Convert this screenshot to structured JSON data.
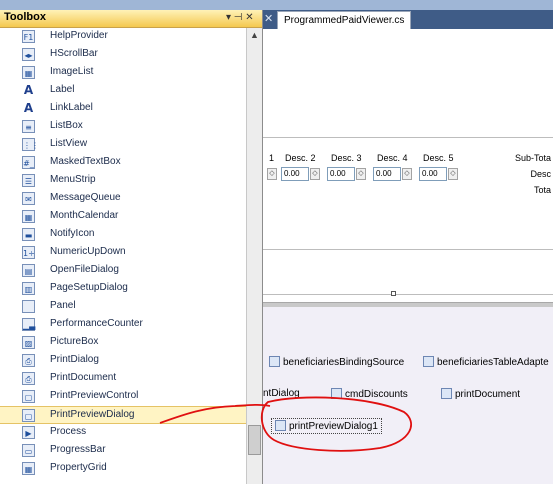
{
  "toolbox": {
    "title": "Toolbox",
    "pin_label": "▾ ⊣ ✕",
    "items": [
      {
        "label": "HelpProvider",
        "icon": "help-provider-icon",
        "glyph": "F1"
      },
      {
        "label": "HScrollBar",
        "icon": "hscrollbar-icon",
        "glyph": "◂▸"
      },
      {
        "label": "ImageList",
        "icon": "imagelist-icon",
        "glyph": "▦"
      },
      {
        "label": "Label",
        "icon": "label-icon",
        "glyph": "A"
      },
      {
        "label": "LinkLabel",
        "icon": "linklabel-icon",
        "glyph": "A"
      },
      {
        "label": "ListBox",
        "icon": "listbox-icon",
        "glyph": "≡"
      },
      {
        "label": "ListView",
        "icon": "listview-icon",
        "glyph": "⋮⋮"
      },
      {
        "label": "MaskedTextBox",
        "icon": "maskedtextbox-icon",
        "glyph": "#_"
      },
      {
        "label": "MenuStrip",
        "icon": "menustrip-icon",
        "glyph": "☰"
      },
      {
        "label": "MessageQueue",
        "icon": "messagequeue-icon",
        "glyph": "✉"
      },
      {
        "label": "MonthCalendar",
        "icon": "monthcalendar-icon",
        "glyph": "▦"
      },
      {
        "label": "NotifyIcon",
        "icon": "notifyicon-icon",
        "glyph": "▬"
      },
      {
        "label": "NumericUpDown",
        "icon": "numericupdown-icon",
        "glyph": "1÷"
      },
      {
        "label": "OpenFileDialog",
        "icon": "openfiledialog-icon",
        "glyph": "▤"
      },
      {
        "label": "PageSetupDialog",
        "icon": "pagesetupdialog-icon",
        "glyph": "▥"
      },
      {
        "label": "Panel",
        "icon": "panel-icon",
        "glyph": ""
      },
      {
        "label": "PerformanceCounter",
        "icon": "performancecounter-icon",
        "glyph": "▁▃"
      },
      {
        "label": "PictureBox",
        "icon": "picturebox-icon",
        "glyph": "▨"
      },
      {
        "label": "PrintDialog",
        "icon": "printdialog-icon",
        "glyph": "⎙"
      },
      {
        "label": "PrintDocument",
        "icon": "printdocument-icon",
        "glyph": "⎙"
      },
      {
        "label": "PrintPreviewControl",
        "icon": "printpreviewcontrol-icon",
        "glyph": "▢"
      },
      {
        "label": "PrintPreviewDialog",
        "icon": "printpreviewdialog-icon",
        "glyph": "▢"
      },
      {
        "label": "Process",
        "icon": "process-icon",
        "glyph": "▶"
      },
      {
        "label": "ProgressBar",
        "icon": "progressbar-icon",
        "glyph": "▭"
      },
      {
        "label": "PropertyGrid",
        "icon": "propertygrid-icon",
        "glyph": "▦"
      }
    ],
    "selected_index": 21
  },
  "editor": {
    "tab_label": "ProgrammedPaidViewer.cs",
    "headers": [
      "1",
      "Desc. 2",
      "Desc. 3",
      "Desc. 4",
      "Desc. 5"
    ],
    "spin_values": [
      "0.00",
      "0.00",
      "0.00",
      "0.00"
    ],
    "right_labels": [
      "Sub-Tota",
      "Desc",
      "Tota"
    ]
  },
  "tray": {
    "components": [
      {
        "name": "beneficiariesBindingSource"
      },
      {
        "name": "beneficiariesTableAdapte"
      },
      {
        "name": "ntDialog"
      },
      {
        "name": "cmdDiscounts"
      },
      {
        "name": "printDocument"
      },
      {
        "name": "printPreviewDialog1"
      }
    ]
  },
  "colors": {
    "selection_highlight": "#fff4c4",
    "annotation_red": "#e01010",
    "tab_strip": "#3f5c87",
    "toolbox_header": "#f4c84f"
  }
}
